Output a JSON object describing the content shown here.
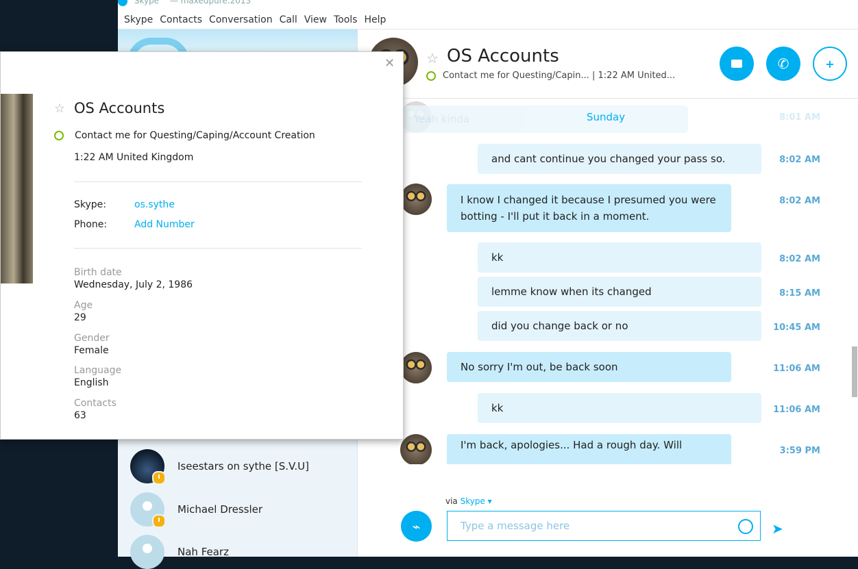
{
  "window": {
    "title": "Skype™ — maxedpure.2013"
  },
  "menu": [
    "Skype",
    "Contacts",
    "Conversation",
    "Call",
    "View",
    "Tools",
    "Help"
  ],
  "contacts": [
    {
      "name": "Iseestars on sythe [S.V.U]"
    },
    {
      "name": "Michael Dressler"
    },
    {
      "name": "Nah Fearz"
    }
  ],
  "conversation": {
    "name": "OS Accounts",
    "status": "Contact me for Questing/Capin...  |  1:22 AM United...",
    "faded_text": "Yeah kinda",
    "faded_time": "8:01 AM",
    "day_label": "Sunday",
    "messages": [
      {
        "dir": "out",
        "text": "and cant continue you changed your pass so.",
        "time": "8:02 AM"
      },
      {
        "dir": "in",
        "text": "I know I changed it because I presumed you were botting - I'll put it back in a moment.",
        "time": "8:02 AM"
      },
      {
        "dir": "out",
        "text": "kk",
        "time": "8:02 AM"
      },
      {
        "dir": "out",
        "text": "lemme know when its changed",
        "time": "8:15 AM"
      },
      {
        "dir": "out",
        "text": "did you change back or no",
        "time": "10:45 AM"
      },
      {
        "dir": "in",
        "text": "No sorry I'm out, be back soon",
        "time": "11:06 AM"
      },
      {
        "dir": "out",
        "text": "kk",
        "time": "11:06 AM"
      },
      {
        "dir": "in",
        "text": "I'm back, apologies... Had a rough day. Will",
        "time": "3:59 PM"
      }
    ]
  },
  "composer": {
    "via_label": "via",
    "via_link": "Skype ▾",
    "placeholder": "Type a message here"
  },
  "profile": {
    "name": "OS Accounts",
    "mood": "Contact me for Questing/Caping/Account Creation",
    "local_time": "1:22 AM United Kingdom",
    "skype_label": "Skype:",
    "skype_value": "os.sythe",
    "phone_label": "Phone:",
    "phone_value": "Add Number",
    "birth_label": "Birth date",
    "birth_value": "Wednesday, July 2, 1986",
    "age_label": "Age",
    "age_value": "29",
    "gender_label": "Gender",
    "gender_value": "Female",
    "language_label": "Language",
    "language_value": "English",
    "contacts_label": "Contacts",
    "contacts_value": "63"
  },
  "colors": {
    "accent": "#00aff0",
    "online": "#7cbb00",
    "away": "#f5b20c",
    "bubble_in": "#c7edfc",
    "bubble_out": "#e4f4fc"
  },
  "icons": [
    "video-call-icon",
    "phone-call-icon",
    "add-contact-icon",
    "attach-icon",
    "emoji-icon",
    "send-icon",
    "close-icon",
    "favorite-star-icon"
  ]
}
